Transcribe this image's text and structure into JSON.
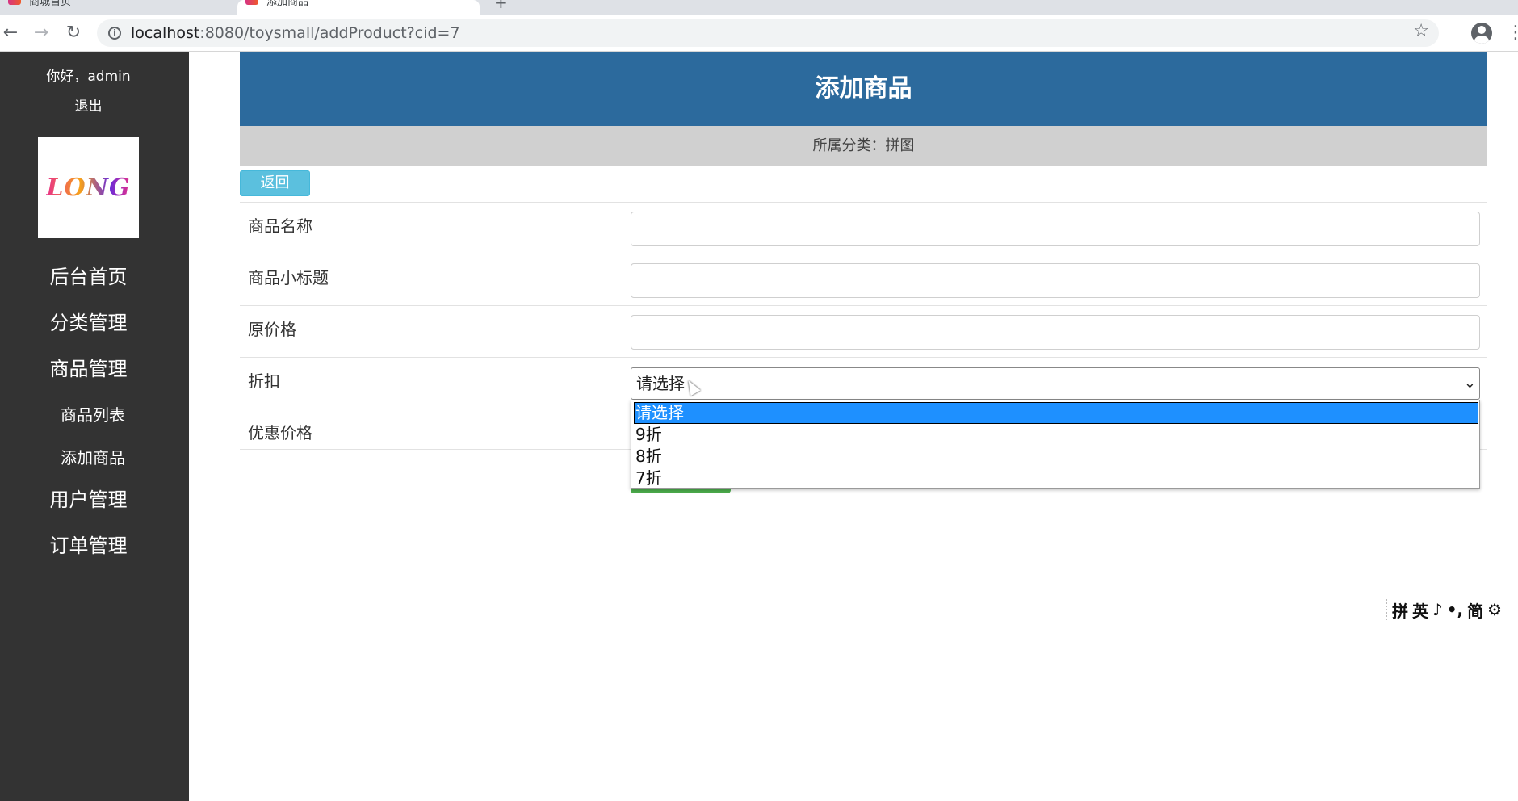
{
  "browser": {
    "tabs": [
      {
        "title": "商城首页"
      },
      {
        "title": "添加商品"
      }
    ],
    "url_host": "localhost",
    "url_rest": ":8080/toysmall/addProduct?cid=7"
  },
  "sidebar": {
    "greeting": "你好，admin",
    "logout": "退出",
    "logo_text": "LONG",
    "menu": {
      "home": "后台首页",
      "category": "分类管理",
      "product": "商品管理",
      "product_list": "商品列表",
      "add_product": "添加商品",
      "user": "用户管理",
      "order": "订单管理"
    }
  },
  "main": {
    "title": "添加商品",
    "category_line": "所属分类：拼图",
    "back_label": "返回",
    "fields": {
      "name_label": "商品名称",
      "subtitle_label": "商品小标题",
      "price_label": "原价格",
      "discount_label": "折扣",
      "sale_price_label": "优惠价格"
    },
    "discount_select": {
      "selected": "请选择",
      "options": [
        "请选择",
        "9折",
        "8折",
        "7折"
      ]
    }
  },
  "ime": {
    "items": [
      "拼",
      "英",
      "♪",
      "•,",
      "简",
      "⚙"
    ]
  },
  "colors": {
    "sidebar_bg": "#333333",
    "header_bg": "#2c6a9d",
    "category_bg": "#d0d0d0",
    "back_button": "#5bc0de",
    "dropdown_highlight": "#1e90ff",
    "submit_button": "#4cae4c"
  }
}
